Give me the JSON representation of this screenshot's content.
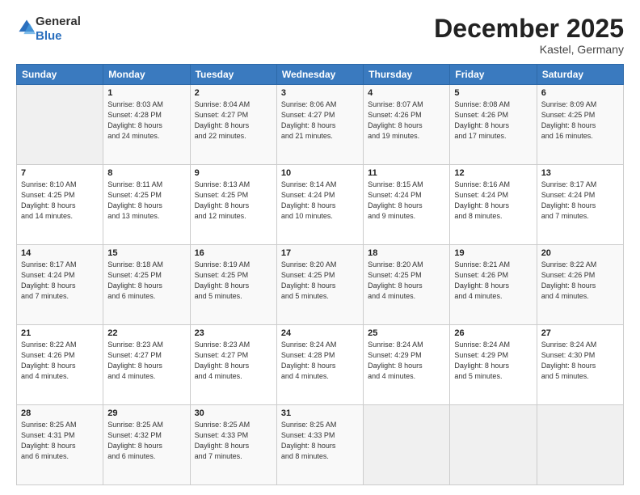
{
  "header": {
    "logo_line1": "General",
    "logo_line2": "Blue",
    "month": "December 2025",
    "location": "Kastel, Germany"
  },
  "days_of_week": [
    "Sunday",
    "Monday",
    "Tuesday",
    "Wednesday",
    "Thursday",
    "Friday",
    "Saturday"
  ],
  "weeks": [
    [
      {
        "day": "",
        "info": ""
      },
      {
        "day": "1",
        "info": "Sunrise: 8:03 AM\nSunset: 4:28 PM\nDaylight: 8 hours\nand 24 minutes."
      },
      {
        "day": "2",
        "info": "Sunrise: 8:04 AM\nSunset: 4:27 PM\nDaylight: 8 hours\nand 22 minutes."
      },
      {
        "day": "3",
        "info": "Sunrise: 8:06 AM\nSunset: 4:27 PM\nDaylight: 8 hours\nand 21 minutes."
      },
      {
        "day": "4",
        "info": "Sunrise: 8:07 AM\nSunset: 4:26 PM\nDaylight: 8 hours\nand 19 minutes."
      },
      {
        "day": "5",
        "info": "Sunrise: 8:08 AM\nSunset: 4:26 PM\nDaylight: 8 hours\nand 17 minutes."
      },
      {
        "day": "6",
        "info": "Sunrise: 8:09 AM\nSunset: 4:25 PM\nDaylight: 8 hours\nand 16 minutes."
      }
    ],
    [
      {
        "day": "7",
        "info": "Sunrise: 8:10 AM\nSunset: 4:25 PM\nDaylight: 8 hours\nand 14 minutes."
      },
      {
        "day": "8",
        "info": "Sunrise: 8:11 AM\nSunset: 4:25 PM\nDaylight: 8 hours\nand 13 minutes."
      },
      {
        "day": "9",
        "info": "Sunrise: 8:13 AM\nSunset: 4:25 PM\nDaylight: 8 hours\nand 12 minutes."
      },
      {
        "day": "10",
        "info": "Sunrise: 8:14 AM\nSunset: 4:24 PM\nDaylight: 8 hours\nand 10 minutes."
      },
      {
        "day": "11",
        "info": "Sunrise: 8:15 AM\nSunset: 4:24 PM\nDaylight: 8 hours\nand 9 minutes."
      },
      {
        "day": "12",
        "info": "Sunrise: 8:16 AM\nSunset: 4:24 PM\nDaylight: 8 hours\nand 8 minutes."
      },
      {
        "day": "13",
        "info": "Sunrise: 8:17 AM\nSunset: 4:24 PM\nDaylight: 8 hours\nand 7 minutes."
      }
    ],
    [
      {
        "day": "14",
        "info": "Sunrise: 8:17 AM\nSunset: 4:24 PM\nDaylight: 8 hours\nand 7 minutes."
      },
      {
        "day": "15",
        "info": "Sunrise: 8:18 AM\nSunset: 4:25 PM\nDaylight: 8 hours\nand 6 minutes."
      },
      {
        "day": "16",
        "info": "Sunrise: 8:19 AM\nSunset: 4:25 PM\nDaylight: 8 hours\nand 5 minutes."
      },
      {
        "day": "17",
        "info": "Sunrise: 8:20 AM\nSunset: 4:25 PM\nDaylight: 8 hours\nand 5 minutes."
      },
      {
        "day": "18",
        "info": "Sunrise: 8:20 AM\nSunset: 4:25 PM\nDaylight: 8 hours\nand 4 minutes."
      },
      {
        "day": "19",
        "info": "Sunrise: 8:21 AM\nSunset: 4:26 PM\nDaylight: 8 hours\nand 4 minutes."
      },
      {
        "day": "20",
        "info": "Sunrise: 8:22 AM\nSunset: 4:26 PM\nDaylight: 8 hours\nand 4 minutes."
      }
    ],
    [
      {
        "day": "21",
        "info": "Sunrise: 8:22 AM\nSunset: 4:26 PM\nDaylight: 8 hours\nand 4 minutes."
      },
      {
        "day": "22",
        "info": "Sunrise: 8:23 AM\nSunset: 4:27 PM\nDaylight: 8 hours\nand 4 minutes."
      },
      {
        "day": "23",
        "info": "Sunrise: 8:23 AM\nSunset: 4:27 PM\nDaylight: 8 hours\nand 4 minutes."
      },
      {
        "day": "24",
        "info": "Sunrise: 8:24 AM\nSunset: 4:28 PM\nDaylight: 8 hours\nand 4 minutes."
      },
      {
        "day": "25",
        "info": "Sunrise: 8:24 AM\nSunset: 4:29 PM\nDaylight: 8 hours\nand 4 minutes."
      },
      {
        "day": "26",
        "info": "Sunrise: 8:24 AM\nSunset: 4:29 PM\nDaylight: 8 hours\nand 5 minutes."
      },
      {
        "day": "27",
        "info": "Sunrise: 8:24 AM\nSunset: 4:30 PM\nDaylight: 8 hours\nand 5 minutes."
      }
    ],
    [
      {
        "day": "28",
        "info": "Sunrise: 8:25 AM\nSunset: 4:31 PM\nDaylight: 8 hours\nand 6 minutes."
      },
      {
        "day": "29",
        "info": "Sunrise: 8:25 AM\nSunset: 4:32 PM\nDaylight: 8 hours\nand 6 minutes."
      },
      {
        "day": "30",
        "info": "Sunrise: 8:25 AM\nSunset: 4:33 PM\nDaylight: 8 hours\nand 7 minutes."
      },
      {
        "day": "31",
        "info": "Sunrise: 8:25 AM\nSunset: 4:33 PM\nDaylight: 8 hours\nand 8 minutes."
      },
      {
        "day": "",
        "info": ""
      },
      {
        "day": "",
        "info": ""
      },
      {
        "day": "",
        "info": ""
      }
    ]
  ]
}
